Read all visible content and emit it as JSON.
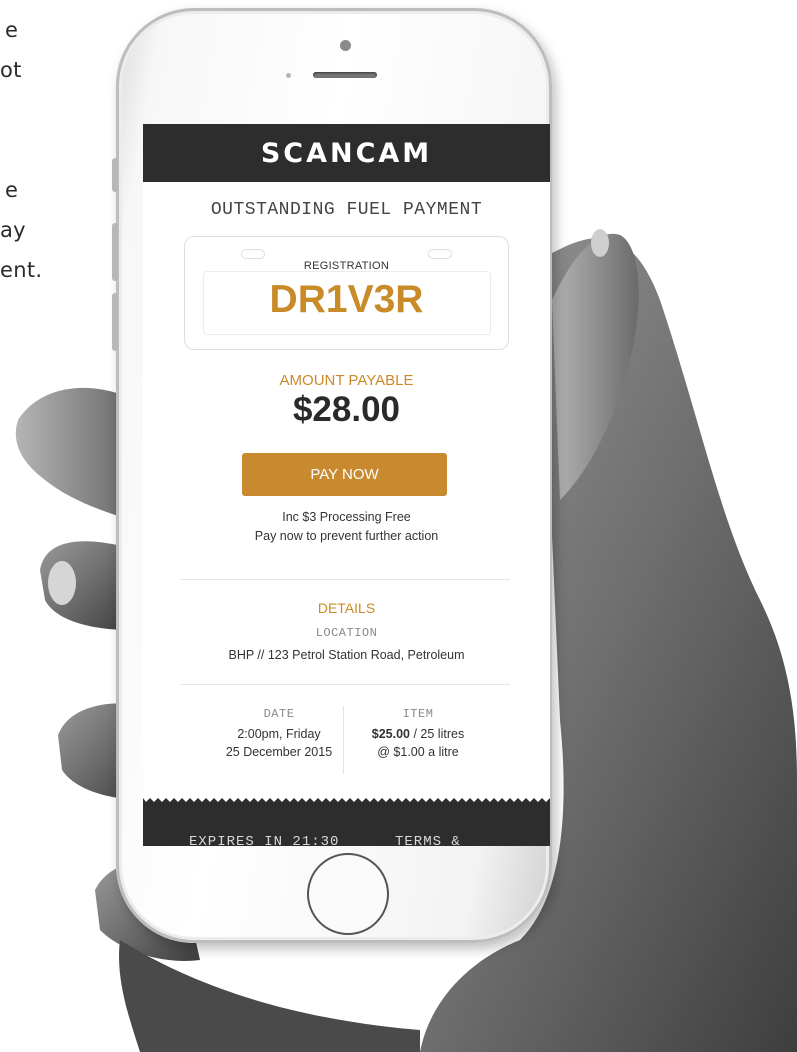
{
  "background_text": {
    "line1": "e",
    "line2": "ot",
    "line3": "e",
    "line4": "ay",
    "line5": "ent."
  },
  "app": {
    "brand": "SCANCAM",
    "page_title": "OUTSTANDING FUEL PAYMENT",
    "registration_label": "REGISTRATION",
    "registration_value": "DR1V3R",
    "amount_label": "AMOUNT PAYABLE",
    "amount_value": "$28.00",
    "pay_button": "PAY NOW",
    "fee_note": "Inc $3 Processing Free",
    "action_note": "Pay now to prevent further action",
    "details_heading": "DETAILS",
    "location_label": "LOCATION",
    "location_value": "BHP // 123 Petrol Station Road, Petroleum",
    "date_label": "DATE",
    "date_line1": "2:00pm, Friday",
    "date_line2": "25 December 2015",
    "item_label": "ITEM",
    "item_amount": "$25.00",
    "item_qty": " / 25 litres",
    "item_rate": "@ $1.00 a litre",
    "footer_expires": "EXPIRES IN 21:30",
    "footer_terms": "TERMS &"
  },
  "colors": {
    "accent": "#c98a28",
    "bar": "#2d2d2d"
  }
}
